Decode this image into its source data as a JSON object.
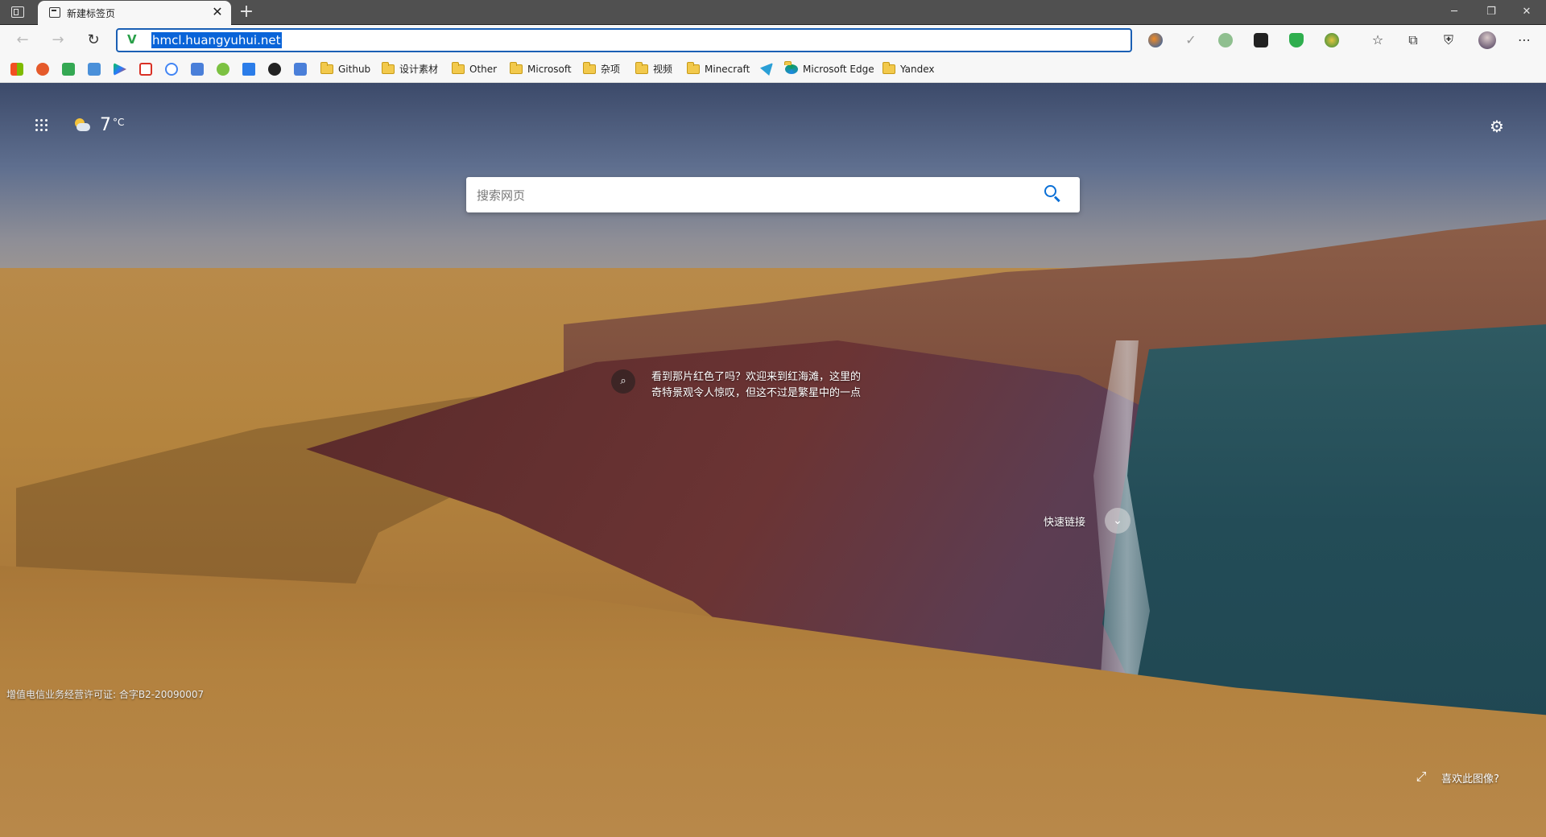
{
  "tab": {
    "title": "新建标签页"
  },
  "address": {
    "url": "hmcl.huangyuhui.net"
  },
  "bookmarks": {
    "folders": [
      "Github",
      "设计素材",
      "Other",
      "Microsoft",
      "杂项",
      "视频",
      "Minecraft"
    ],
    "edge_link": "Microsoft Edge",
    "yandex": "Yandex"
  },
  "weather": {
    "temp": "7",
    "unit": "°C"
  },
  "search": {
    "placeholder": "搜索网页"
  },
  "hotspot": {
    "text": "看到那片红色了吗？欢迎来到红海滩，这里的奇特景观令人惊叹，但这不过是繁星中的一点"
  },
  "quicklinks": {
    "label": "快速链接"
  },
  "footer": {
    "license": "增值电信业务经营许可证: 合字B2-20090007",
    "like": "喜欢此图像?"
  },
  "colors": {
    "accent": "#0a6fd6",
    "tabbar": "#505050",
    "toolbar": "#f7f7f7"
  }
}
